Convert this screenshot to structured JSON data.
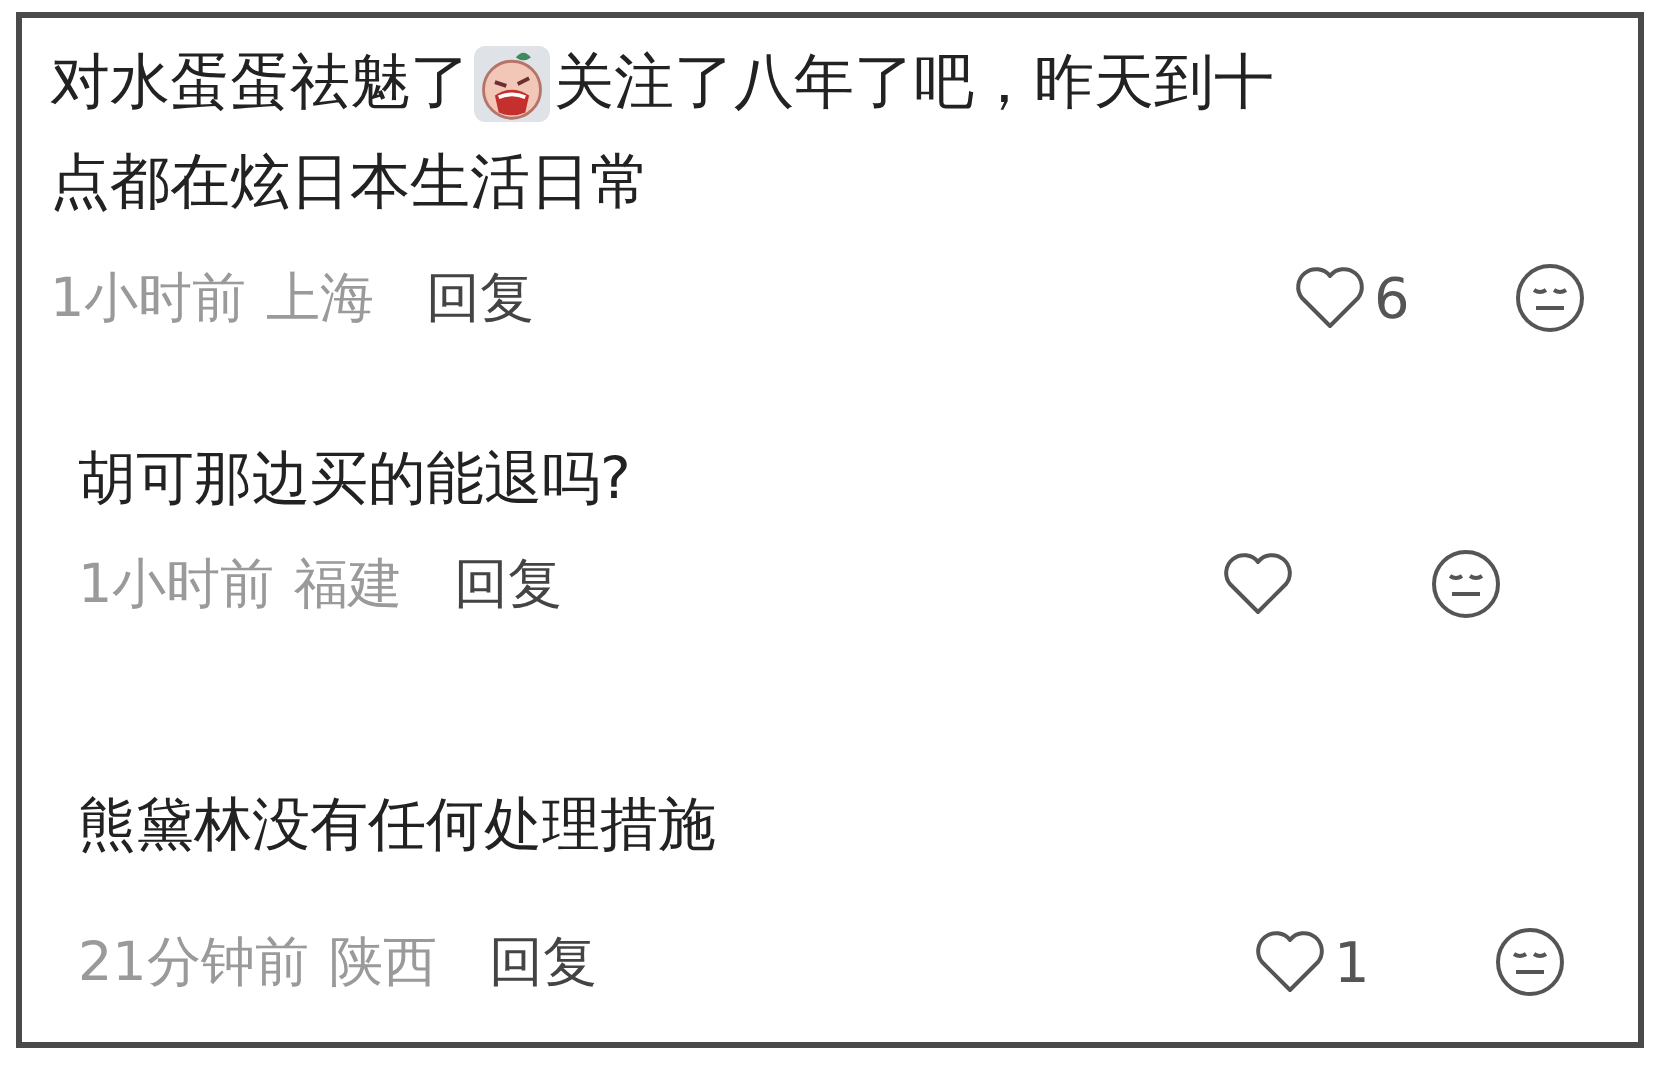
{
  "comments": [
    {
      "text_before_emoji": "对水蛋蛋祛魅了",
      "text_after_emoji": "关注了八年了吧，昨天到十",
      "text_next_line": "点都在炫日本生活日常",
      "time": "1小时前",
      "location": "上海",
      "reply": "回复",
      "likes": "6"
    },
    {
      "text": "胡可那边买的能退吗?",
      "time": "1小时前",
      "location": "福建",
      "reply": "回复"
    },
    {
      "text": "熊黛林没有任何处理措施",
      "time": "21分钟前",
      "location": "陕西",
      "reply": "回复",
      "likes": "1"
    }
  ]
}
